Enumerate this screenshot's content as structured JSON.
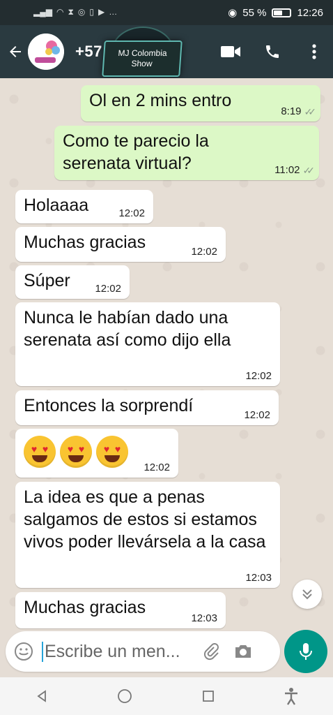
{
  "status_bar": {
    "battery_percent": "55 %",
    "time": "12:26",
    "battery_level": 0.55
  },
  "header": {
    "contact_name": "+57 3 28",
    "watermark_line1": "MJ Colombia",
    "watermark_line2": "Show"
  },
  "messages": [
    {
      "direction": "out",
      "text": "Ol en 2 mins entro",
      "time": "8:19",
      "status": "read"
    },
    {
      "direction": "out",
      "text": "Como te parecio la serenata virtual?",
      "time": "11:02",
      "status": "read"
    },
    {
      "direction": "in",
      "text": "Holaaaa",
      "time": "12:02"
    },
    {
      "direction": "in",
      "text": "Muchas gracias",
      "time": "12:02"
    },
    {
      "direction": "in",
      "text": "Súper",
      "time": "12:02"
    },
    {
      "direction": "in",
      "text": "Nunca le habían dado una serenata así como dijo ella",
      "time": "12:02"
    },
    {
      "direction": "in",
      "text": "Entonces la sorprendí",
      "time": "12:02"
    },
    {
      "direction": "in",
      "text": "",
      "emoji": [
        "heart-eyes",
        "heart-eyes",
        "heart-eyes"
      ],
      "time": "12:02"
    },
    {
      "direction": "in",
      "text": "La idea es que a penas salgamos de estos si estamos vivos poder llevársela a la casa",
      "time": "12:03"
    },
    {
      "direction": "in",
      "text": "Muchas gracias",
      "time": "12:03"
    }
  ],
  "composer": {
    "placeholder": "Escribe un men..."
  },
  "colors": {
    "header": "#2a3a40",
    "outgoing_bubble": "#dcf8c6",
    "incoming_bubble": "#ffffff",
    "mic_button": "#009688"
  },
  "icons": {
    "back": "arrow-left-icon",
    "video": "video-call-icon",
    "call": "phone-icon",
    "menu": "more-vert-icon",
    "emoji": "emoji-icon",
    "attach": "paperclip-icon",
    "camera": "camera-icon",
    "mic": "mic-icon",
    "scroll": "chevron-double-down-icon"
  }
}
